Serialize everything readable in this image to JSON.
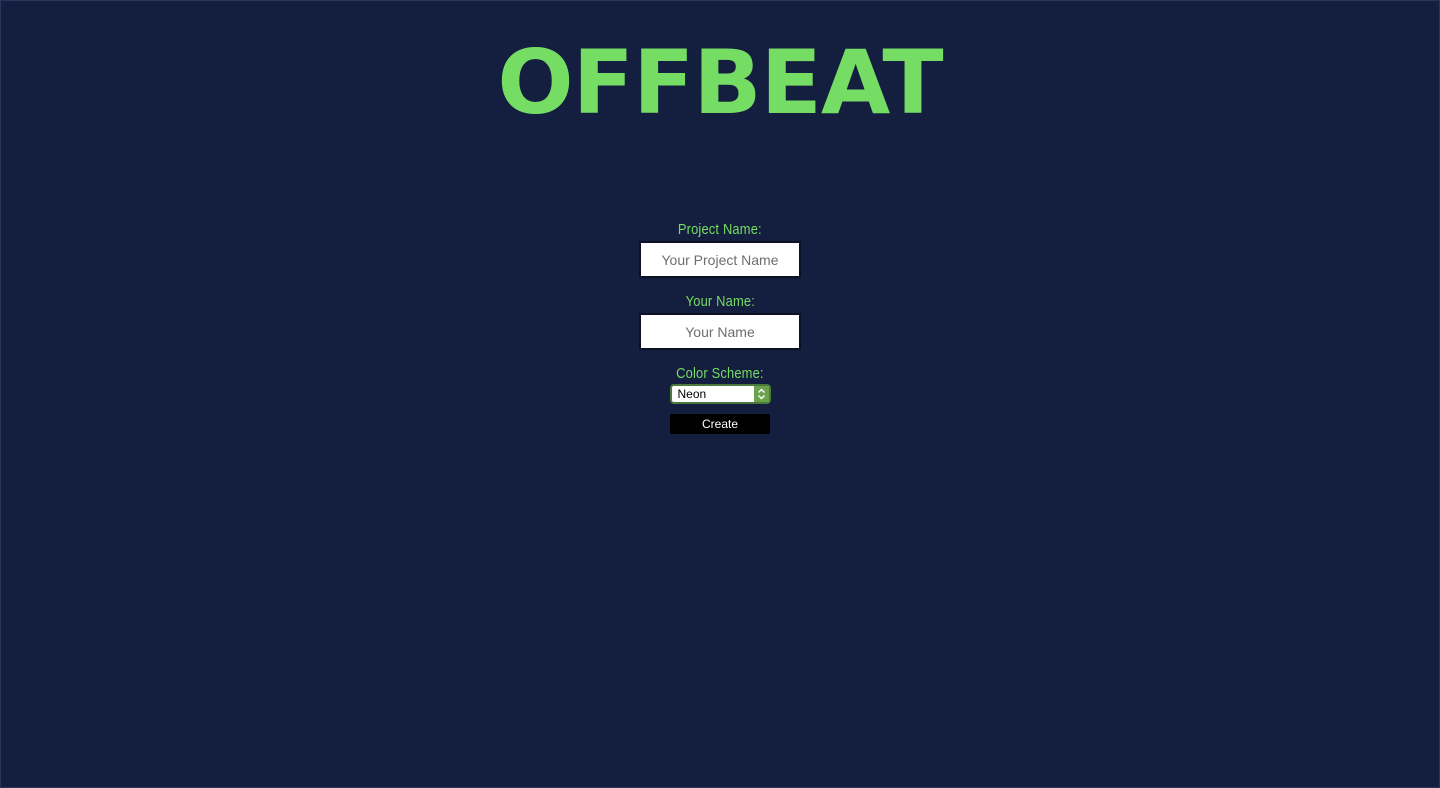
{
  "app": {
    "logo_text": "OFFBEAT"
  },
  "form": {
    "project_name_label": "Project Name:",
    "project_name_placeholder": "Your Project Name",
    "project_name_value": "",
    "your_name_label": "Your Name:",
    "your_name_placeholder": "Your Name",
    "your_name_value": "",
    "color_scheme_label": "Color Scheme:",
    "color_scheme_selected": "Neon",
    "create_label": "Create"
  },
  "icons": {
    "select_arrow": "chevron-up-down-icon"
  },
  "colors": {
    "background": "#141e3f",
    "accent": "#75dd63",
    "select_arrow_bg": "#6aa24e",
    "button_bg": "#000000",
    "button_text": "#ffffff"
  }
}
